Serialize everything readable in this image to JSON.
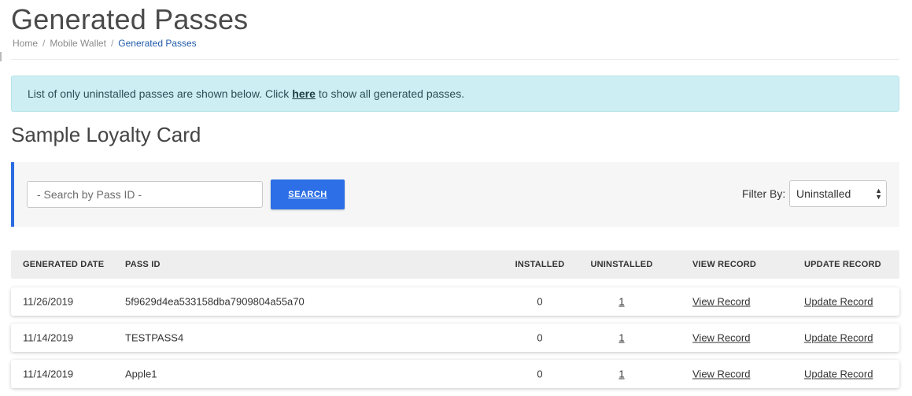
{
  "page": {
    "title": "Generated Passes",
    "breadcrumb": [
      "Home",
      "Mobile Wallet",
      "Generated Passes"
    ],
    "breadcrumb_sep": "/"
  },
  "alert": {
    "text_before": "List of only uninstalled passes are shown below. Click",
    "link": "here",
    "text_after": "to show all generated passes."
  },
  "section": {
    "title": "Sample Loyalty Card"
  },
  "search": {
    "placeholder": "- Search by Pass ID -",
    "button": "SEARCH",
    "filter_label": "Filter By:",
    "filter_value": "Uninstalled"
  },
  "table": {
    "columns": [
      "GENERATED DATE",
      "PASS ID",
      "INSTALLED",
      "UNINSTALLED",
      "VIEW RECORD",
      "UPDATE RECORD"
    ],
    "rows": [
      {
        "date": "11/26/2019",
        "pass_id": "5f9629d4ea533158dba7909804a55a70",
        "installed": "0",
        "uninstalled": "1",
        "view": "View Record",
        "update": "Update Record"
      },
      {
        "date": "11/14/2019",
        "pass_id": "TESTPASS4",
        "installed": "0",
        "uninstalled": "1",
        "view": "View Record",
        "update": "Update Record"
      },
      {
        "date": "11/14/2019",
        "pass_id": "Apple1",
        "installed": "0",
        "uninstalled": "1",
        "view": "View Record",
        "update": "Update Record"
      }
    ]
  },
  "colors": {
    "accent": "#2c6fe6",
    "alert_bg": "#cdeef3",
    "breadcrumb_active": "#1f5aa8"
  }
}
